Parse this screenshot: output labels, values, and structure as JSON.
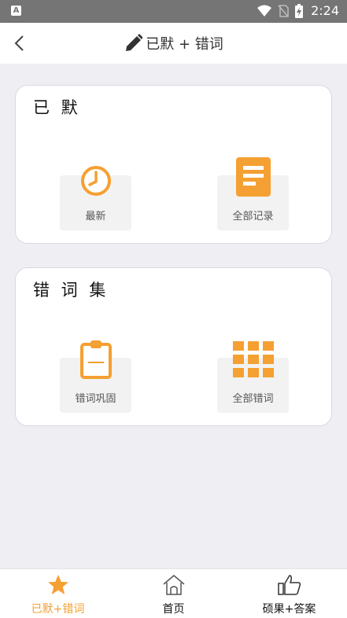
{
  "status_bar": {
    "time": "2:24",
    "notification_icon": "a-icon"
  },
  "header": {
    "title": "已默 + 错词",
    "back_icon": "chevron-left-icon",
    "title_icon": "pencil-icon"
  },
  "sections": [
    {
      "title": "已 默",
      "tiles": [
        {
          "label": "最新",
          "icon": "clock-icon"
        },
        {
          "label": "全部记录",
          "icon": "document-icon"
        }
      ]
    },
    {
      "title": "错 词 集",
      "tiles": [
        {
          "label": "错词巩固",
          "icon": "clipboard-icon"
        },
        {
          "label": "全部错词",
          "icon": "grid-icon"
        }
      ]
    }
  ],
  "tabs": [
    {
      "label": "已默+错词",
      "icon": "star-icon",
      "active": true
    },
    {
      "label": "首页",
      "icon": "home-icon",
      "active": false
    },
    {
      "label": "硕果+答案",
      "icon": "thumbs-up-icon",
      "active": false
    }
  ],
  "colors": {
    "accent": "#f5a032",
    "status_bar": "#757575",
    "background": "#efeef3"
  }
}
